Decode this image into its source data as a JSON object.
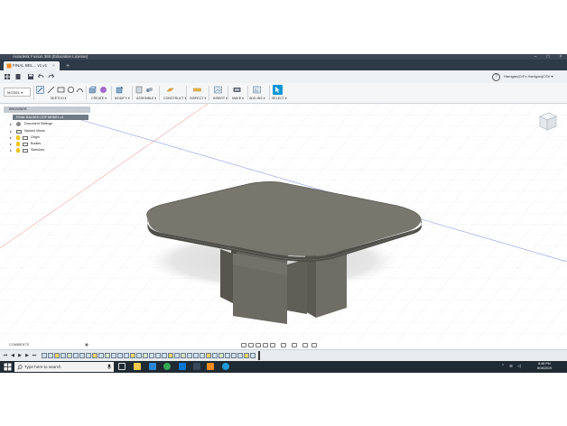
{
  "window": {
    "title": "Autodesk Fusion 360 (Education License)",
    "min": "–",
    "max": "□",
    "close": "×"
  },
  "document_tab": {
    "label": "FINAL BEL... v1 v1",
    "close": "×",
    "new_tab": "+"
  },
  "account": {
    "name": "Harrigan(CrFx Harrigan(CSV ▾"
  },
  "help": "?",
  "workspace": {
    "label": "MODEL ▾"
  },
  "toolbar_groups": [
    {
      "label": "SKETCH ▾"
    },
    {
      "label": "CREATE ▾"
    },
    {
      "label": "MODIFY ▾"
    },
    {
      "label": "ASSEMBLE ▾"
    },
    {
      "label": "CONSTRUCT ▾"
    },
    {
      "label": "INSPECT ▾"
    },
    {
      "label": "INSERT ▾"
    },
    {
      "label": "MAKE ▾"
    },
    {
      "label": "ADD-INS ▾"
    },
    {
      "label": "SELECT ▾"
    }
  ],
  "browser": {
    "header": "BROWSER",
    "root": "FINAL BALDED COF MODEL v1",
    "nodes": [
      {
        "label": "Document Settings"
      },
      {
        "label": "Named Views"
      },
      {
        "label": "Origin"
      },
      {
        "label": "Bodies"
      },
      {
        "label": "Sketches"
      }
    ]
  },
  "comments": {
    "label": "COMMENTS"
  },
  "taskbar": {
    "search_placeholder": "Type here to search",
    "time": "8:48 PM",
    "date": "8/16/2019"
  },
  "colors": {
    "titlebar": "#3c4654",
    "accent": "#0696d7",
    "taskbar": "#1f2a33",
    "model": "#6a6a62"
  }
}
